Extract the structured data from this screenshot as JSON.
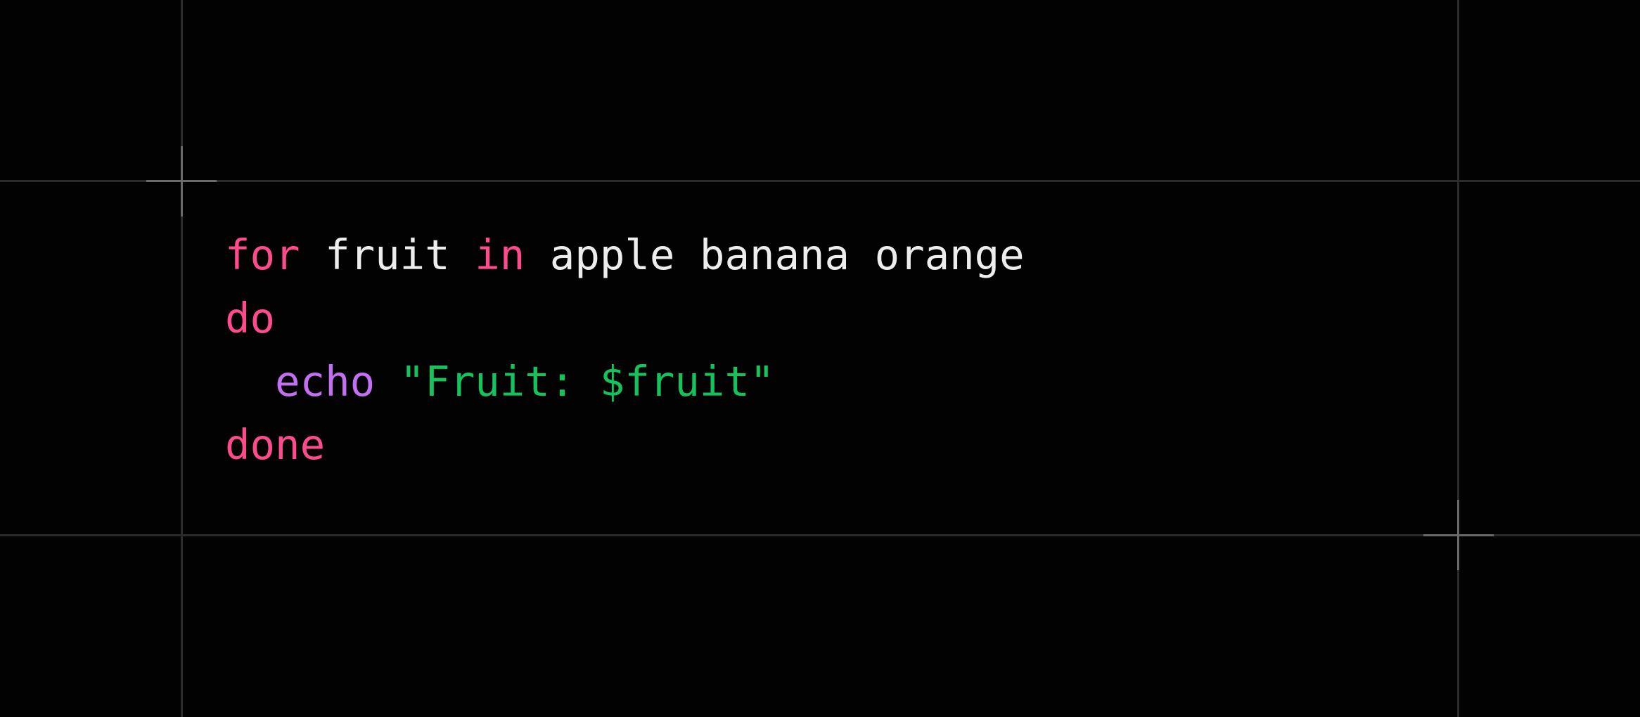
{
  "colors": {
    "background": "#020202",
    "gridline": "#2b2b2b",
    "crosshair": "#6a6a6a",
    "keyword": "#ff4a8d",
    "builtin": "#c26ff2",
    "string": "#16c25b",
    "text": "#ededed"
  },
  "code": {
    "language": "bash",
    "lines": [
      {
        "tokens": [
          {
            "type": "keyword",
            "text": "for"
          },
          {
            "type": "plain",
            "text": " fruit "
          },
          {
            "type": "keyword",
            "text": "in"
          },
          {
            "type": "plain",
            "text": " apple banana orange"
          }
        ]
      },
      {
        "tokens": [
          {
            "type": "keyword",
            "text": "do"
          }
        ]
      },
      {
        "tokens": [
          {
            "type": "plain",
            "text": "  "
          },
          {
            "type": "builtin",
            "text": "echo"
          },
          {
            "type": "plain",
            "text": " "
          },
          {
            "type": "string",
            "text": "\"Fruit: $fruit\""
          }
        ]
      },
      {
        "tokens": [
          {
            "type": "keyword",
            "text": "done"
          }
        ]
      }
    ]
  }
}
